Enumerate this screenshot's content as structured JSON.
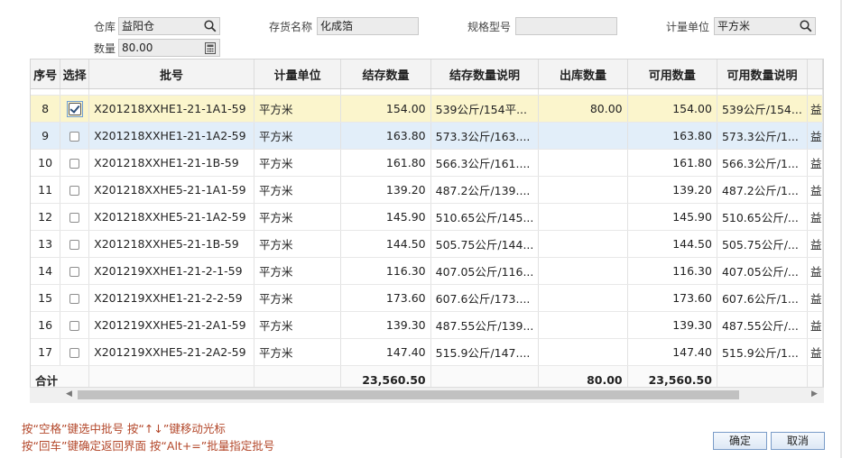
{
  "filters": {
    "warehouse_label": "仓库",
    "warehouse_value": "益阳仓",
    "quantity_label": "数量",
    "quantity_value": "80.00",
    "item_name_label": "存货名称",
    "item_name_value": "化成箔",
    "spec_label": "规格型号",
    "spec_value": "",
    "unit_label": "计量单位",
    "unit_value": "平方米"
  },
  "table": {
    "headers": [
      "序号",
      "选择",
      "批号",
      "计量单位",
      "结存数量",
      "结存数量说明",
      "出库数量",
      "可用数量",
      "可用数量说明"
    ],
    "rows": [
      {
        "no": "8",
        "checked": true,
        "batch": "X201218XXHE1-21-1A1-59",
        "unit": "平方米",
        "stock": "154.00",
        "stock_desc": "539公斤/154平...",
        "out": "80.00",
        "avail": "154.00",
        "avail_desc": "539公斤/154...",
        "extra": "益"
      },
      {
        "no": "9",
        "checked": false,
        "batch": "X201218XXHE1-21-1A2-59",
        "unit": "平方米",
        "stock": "163.80",
        "stock_desc": "573.3公斤/163....",
        "out": "",
        "avail": "163.80",
        "avail_desc": "573.3公斤/1...",
        "extra": "益"
      },
      {
        "no": "10",
        "checked": false,
        "batch": "X201218XXHE1-21-1B-59",
        "unit": "平方米",
        "stock": "161.80",
        "stock_desc": "566.3公斤/161....",
        "out": "",
        "avail": "161.80",
        "avail_desc": "566.3公斤/1...",
        "extra": "益"
      },
      {
        "no": "11",
        "checked": false,
        "batch": "X201218XXHE5-21-1A1-59",
        "unit": "平方米",
        "stock": "139.20",
        "stock_desc": "487.2公斤/139....",
        "out": "",
        "avail": "139.20",
        "avail_desc": "487.2公斤/1...",
        "extra": "益"
      },
      {
        "no": "12",
        "checked": false,
        "batch": "X201218XXHE5-21-1A2-59",
        "unit": "平方米",
        "stock": "145.90",
        "stock_desc": "510.65公斤/145...",
        "out": "",
        "avail": "145.90",
        "avail_desc": "510.65公斤/...",
        "extra": "益"
      },
      {
        "no": "13",
        "checked": false,
        "batch": "X201218XXHE5-21-1B-59",
        "unit": "平方米",
        "stock": "144.50",
        "stock_desc": "505.75公斤/144...",
        "out": "",
        "avail": "144.50",
        "avail_desc": "505.75公斤/...",
        "extra": "益"
      },
      {
        "no": "14",
        "checked": false,
        "batch": "X201219XXHE1-21-2-1-59",
        "unit": "平方米",
        "stock": "116.30",
        "stock_desc": "407.05公斤/116...",
        "out": "",
        "avail": "116.30",
        "avail_desc": "407.05公斤/...",
        "extra": "益"
      },
      {
        "no": "15",
        "checked": false,
        "batch": "X201219XXHE1-21-2-2-59",
        "unit": "平方米",
        "stock": "173.60",
        "stock_desc": "607.6公斤/173....",
        "out": "",
        "avail": "173.60",
        "avail_desc": "607.6公斤/1...",
        "extra": "益"
      },
      {
        "no": "16",
        "checked": false,
        "batch": "X201219XXHE5-21-2A1-59",
        "unit": "平方米",
        "stock": "139.30",
        "stock_desc": "487.55公斤/139...",
        "out": "",
        "avail": "139.30",
        "avail_desc": "487.55公斤/...",
        "extra": "益"
      },
      {
        "no": "17",
        "checked": false,
        "batch": "X201219XXHE5-21-2A2-59",
        "unit": "平方米",
        "stock": "147.40",
        "stock_desc": "515.9公斤/147....",
        "out": "",
        "avail": "147.40",
        "avail_desc": "515.9公斤/1...",
        "extra": "益"
      }
    ],
    "totals": {
      "label": "合计",
      "stock": "23,560.50",
      "out": "80.00",
      "avail": "23,560.50"
    }
  },
  "hints": {
    "line1": "按“空格”键选中批号   按“↑↓”键移动光标",
    "line2": "按“回车”键确定返回界面 按“Alt+=”批量指定批号"
  },
  "buttons": {
    "ok": "确定",
    "cancel": "取消"
  },
  "icons": {
    "lookup": "search-icon",
    "calculator": "calculator-icon"
  },
  "colors": {
    "selected_row": "#fbf5cc",
    "hover_row": "#e2eef9",
    "hint_text": "#b3472a"
  }
}
